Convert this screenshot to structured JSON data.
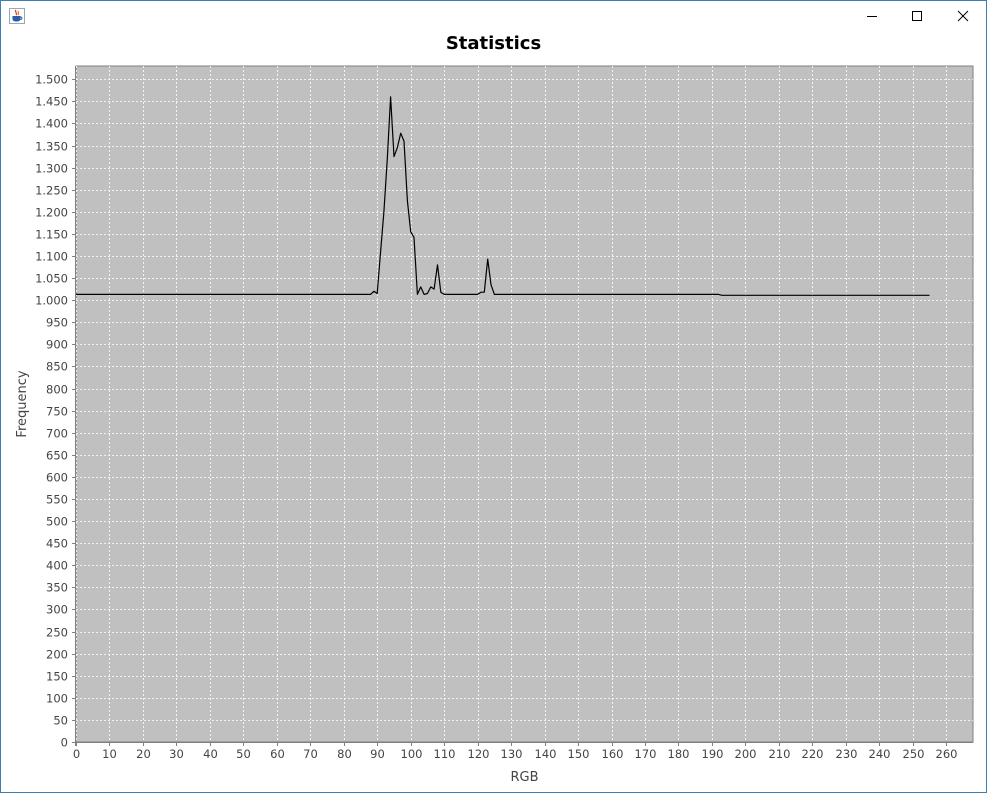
{
  "window": {
    "icon": "java-cup-icon",
    "controls": [
      "minimize-icon",
      "maximize-icon",
      "close-icon"
    ]
  },
  "chart_data": {
    "type": "line",
    "title": "Statistics",
    "xlabel": "RGB",
    "ylabel": "Frequency",
    "xlim": [
      0,
      268
    ],
    "ylim": [
      0,
      1530
    ],
    "grid": true,
    "legend": "none",
    "colors": {
      "plot_bg": "#c0c0c0",
      "grid": "#ffffff",
      "line": "#000000"
    },
    "x_ticks": [
      0,
      10,
      20,
      30,
      40,
      50,
      60,
      70,
      80,
      90,
      100,
      110,
      120,
      130,
      140,
      150,
      160,
      170,
      180,
      190,
      200,
      210,
      220,
      230,
      240,
      250,
      260
    ],
    "y_ticks": [
      0,
      50,
      100,
      150,
      200,
      250,
      300,
      350,
      400,
      450,
      500,
      550,
      600,
      650,
      700,
      750,
      800,
      850,
      900,
      950,
      1000,
      1050,
      1100,
      1150,
      1200,
      1250,
      1300,
      1350,
      1400,
      1450,
      1500
    ],
    "y_tick_labels": [
      "0",
      "50",
      "100",
      "150",
      "200",
      "250",
      "300",
      "350",
      "400",
      "450",
      "500",
      "550",
      "600",
      "650",
      "700",
      "750",
      "800",
      "850",
      "900",
      "950",
      "1.000",
      "1.050",
      "1.100",
      "1.150",
      "1.200",
      "1.250",
      "1.300",
      "1.350",
      "1.400",
      "1.450",
      "1.500"
    ],
    "series": [
      {
        "x": [
          0,
          88,
          89,
          90,
          91,
          92,
          93,
          94,
          95,
          96,
          97,
          98,
          99,
          100,
          101,
          102,
          103,
          104,
          105,
          106,
          107,
          108,
          109,
          110,
          111,
          120,
          121,
          122,
          123,
          124,
          125,
          130,
          192,
          193,
          255
        ],
        "y": [
          1013,
          1013,
          1020,
          1015,
          1110,
          1200,
          1320,
          1460,
          1325,
          1345,
          1378,
          1360,
          1225,
          1155,
          1142,
          1013,
          1030,
          1013,
          1015,
          1030,
          1025,
          1080,
          1018,
          1013,
          1013,
          1013,
          1018,
          1018,
          1093,
          1035,
          1013,
          1013,
          1013,
          1011,
          1011
        ]
      }
    ]
  }
}
